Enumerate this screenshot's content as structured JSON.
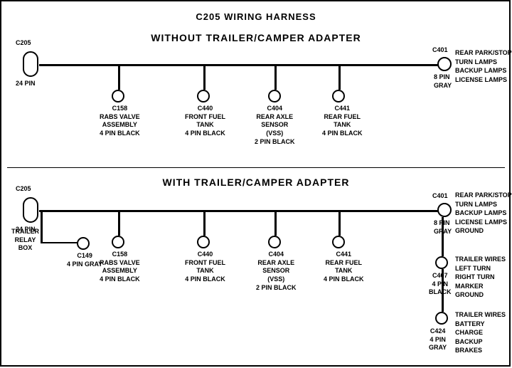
{
  "title": "C205 WIRING HARNESS",
  "section1": {
    "label": "WITHOUT  TRAILER/CAMPER  ADAPTER",
    "connectors": [
      {
        "id": "C205_1",
        "label": "C205",
        "sublabel": "24 PIN"
      },
      {
        "id": "C401_1",
        "label": "C401",
        "sublabel": "8 PIN\nGRAY"
      },
      {
        "id": "C158_1",
        "label": "C158"
      },
      {
        "id": "C440_1",
        "label": "C440"
      },
      {
        "id": "C404_1",
        "label": "C404"
      },
      {
        "id": "C441_1",
        "label": "C441"
      }
    ],
    "c158_label": "C158\nRABS VALVE\nASSEMBLY\n4 PIN BLACK",
    "c440_label": "C440\nFRONT FUEL\nTANK\n4 PIN BLACK",
    "c404_label": "C404\nREAR AXLE\nSENSOR\n(VSS)\n2 PIN BLACK",
    "c441_label": "C441\nREAR FUEL\nTANK\n4 PIN BLACK",
    "c401_right_label": "REAR PARK/STOP\nTURN LAMPS\nBACKUP LAMPS\nLICENSE LAMPS"
  },
  "section2": {
    "label": "WITH  TRAILER/CAMPER  ADAPTER",
    "c205_label": "C205",
    "c205_sublabel": "24 PIN",
    "c401_label": "C401",
    "c401_sublabel": "8 PIN\nGRAY",
    "c158_label": "C158\nRABS VALVE\nASSEMBLY\n4 PIN BLACK",
    "c440_label": "C440\nFRONT FUEL\nTANK\n4 PIN BLACK",
    "c404_label": "C404\nREAR AXLE\nSENSOR\n(VSS)\n2 PIN BLACK",
    "c441_label": "C441\nREAR FUEL\nTANK\n4 PIN BLACK",
    "c401_right_label": "REAR PARK/STOP\nTURN LAMPS\nBACKUP LAMPS\nLICENSE LAMPS\nGROUND",
    "c149_label": "C149\n4 PIN GRAY",
    "trailer_relay_label": "TRAILER\nRELAY\nBOX",
    "c407_label": "C407\n4 PIN\nBLACK",
    "c407_right_label": "TRAILER WIRES\nLEFT TURN\nRIGHT TURN\nMARKER\nGROUND",
    "c424_label": "C424\n4 PIN\nGRAY",
    "c424_right_label": "TRAILER WIRES\nBATTERY CHARGE\nBACKUP\nBRAKES"
  }
}
